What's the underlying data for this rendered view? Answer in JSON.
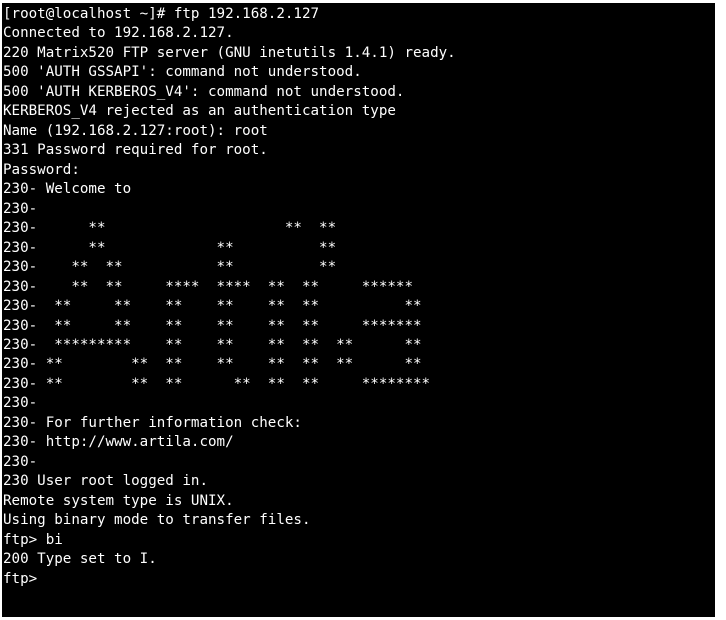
{
  "terminal": {
    "lines": [
      "[root@localhost ~]# ftp 192.168.2.127",
      "Connected to 192.168.2.127.",
      "220 Matrix520 FTP server (GNU inetutils 1.4.1) ready.",
      "500 'AUTH GSSAPI': command not understood.",
      "500 'AUTH KERBEROS_V4': command not understood.",
      "KERBEROS_V4 rejected as an authentication type",
      "Name (192.168.2.127:root): root",
      "331 Password required for root.",
      "Password:",
      "230- Welcome to",
      "230-",
      "230-      **                     **  **",
      "230-      **             **          **",
      "230-    **  **           **          **",
      "230-    **  **     ****  ****  **  **     ******",
      "230-  **     **    **    **    **  **          **",
      "230-  **     **    **    **    **  **     *******",
      "230-  *********    **    **    **  **  **      **",
      "230- **        **  **    **    **  **  **      **",
      "230- **        **  **      **  **  **     ********",
      "230-",
      "230- For further information check:",
      "230- http://www.artila.com/",
      "230-",
      "230 User root logged in.",
      "Remote system type is UNIX.",
      "Using binary mode to transfer files.",
      "ftp> bi",
      "200 Type set to I.",
      "ftp> "
    ]
  }
}
